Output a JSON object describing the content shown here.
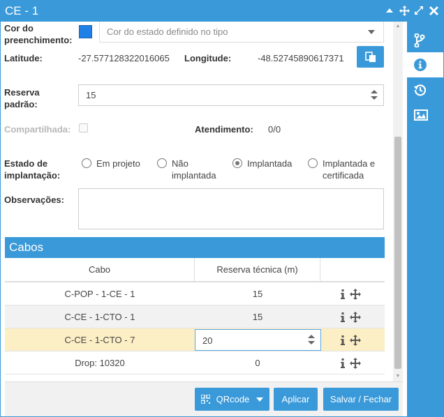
{
  "window": {
    "title": "CE - 1"
  },
  "titlebar_icons": [
    "caret-up-icon",
    "move-icon",
    "expand-icon",
    "close-icon"
  ],
  "side_tabs": [
    {
      "name": "topology-tab",
      "icon": "branch-icon"
    },
    {
      "name": "info-tab",
      "icon": "info-circle-icon",
      "active": true
    },
    {
      "name": "history-tab",
      "icon": "history-icon"
    },
    {
      "name": "images-tab",
      "icon": "image-icon"
    }
  ],
  "form": {
    "fill_color_label": "Cor do preenchimento:",
    "fill_color_value": "#1e7fe6",
    "fill_color_select": "Cor do estado definido no tipo",
    "latitude_label": "Latitude:",
    "latitude_value": "-27.577128322016065",
    "longitude_label": "Longitude:",
    "longitude_value": "-48.52745890617371",
    "reserve_label": "Reserva padrão:",
    "reserve_value": "15",
    "shared_label": "Compartilhada:",
    "attendance_label": "Atendimento:",
    "attendance_value": "0/0",
    "state_label": "Estado de implantação:",
    "state_options": [
      "Em projeto",
      "Não implantada",
      "Implantada",
      "Implantada e certificada"
    ],
    "state_selected": "Implantada",
    "notes_label": "Observações:"
  },
  "cables": {
    "title": "Cabos",
    "columns": [
      "Cabo",
      "Reserva técnica (m)"
    ],
    "rows": [
      {
        "cable": "C-POP - 1-CE - 1",
        "reserve": "15"
      },
      {
        "cable": "C-CE - 1-CTO - 1",
        "reserve": "15"
      },
      {
        "cable": "C-CE - 1-CTO - 7",
        "reserve": "20",
        "editing": true
      },
      {
        "cable": "Drop: 10320",
        "reserve": "0"
      }
    ]
  },
  "footer": {
    "qrcode_label": "QRcode",
    "apply_label": "Aplicar",
    "save_close_label": "Salvar / Fechar"
  },
  "colors": {
    "accent": "#3a9ad9",
    "selected_row": "#fdefc5"
  }
}
